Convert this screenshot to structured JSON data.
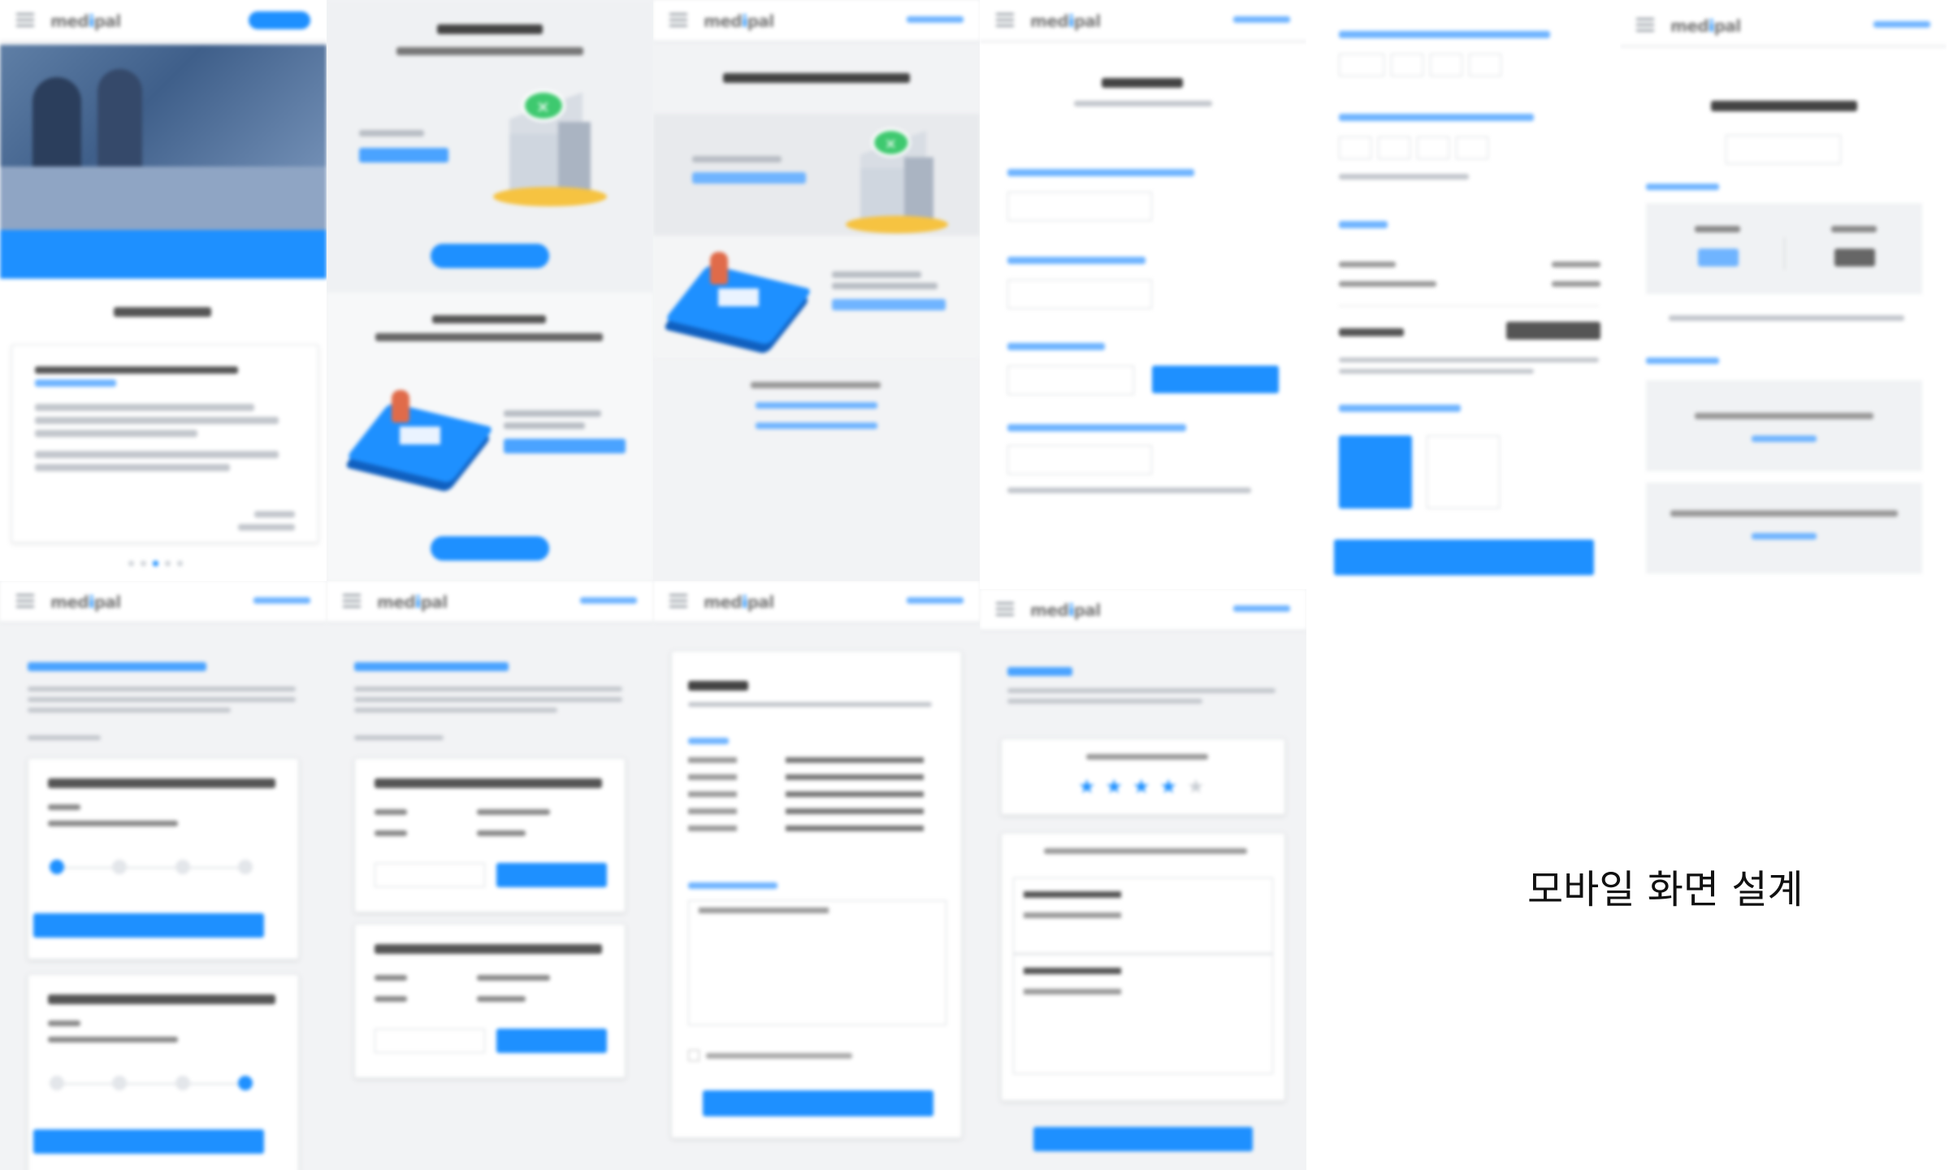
{
  "caption": "모바일 화면 설계"
}
